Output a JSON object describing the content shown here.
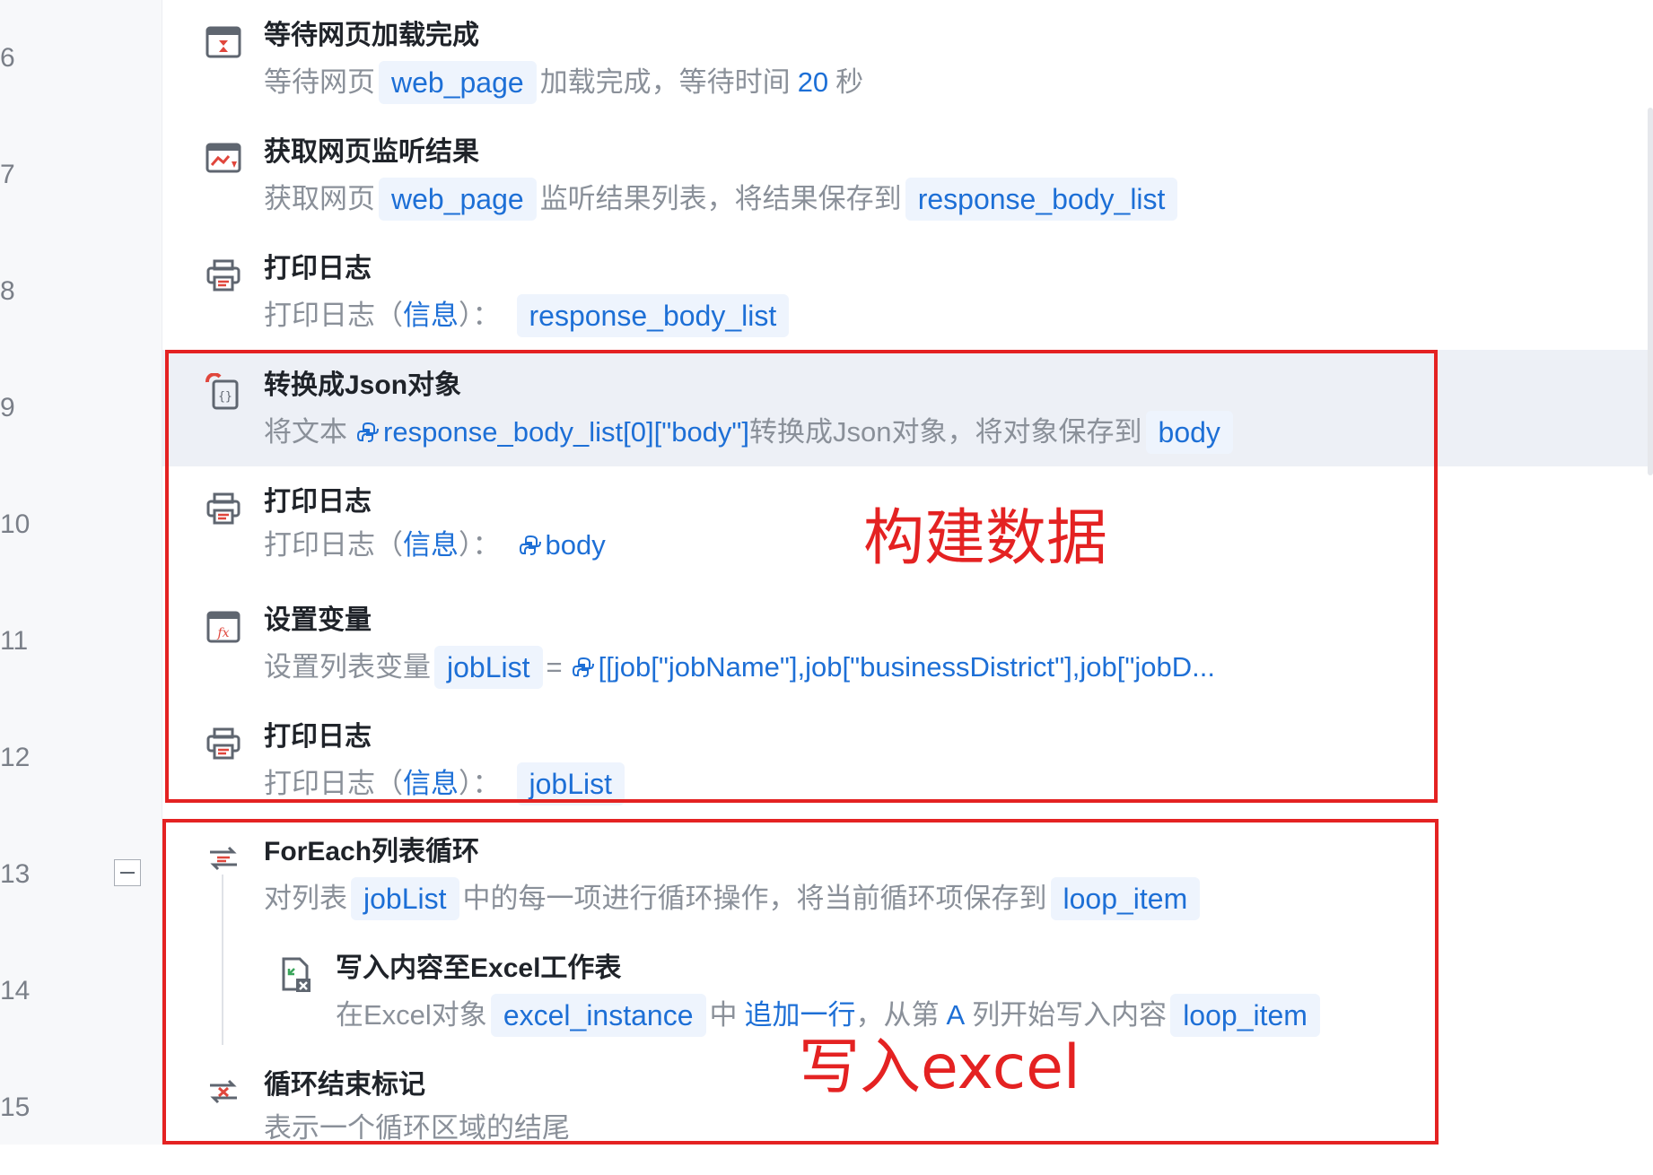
{
  "line_numbers": [
    "6",
    "7",
    "8",
    "9",
    "10",
    "11",
    "12",
    "13",
    "14",
    "15"
  ],
  "steps": [
    {
      "title": "等待网页加载完成",
      "desc": {
        "p1": "等待网页",
        "chip1": "web_page",
        "p2": "加载完成，等待时间",
        "value": "20",
        "p3": "秒"
      }
    },
    {
      "title": "获取网页监听结果",
      "desc": {
        "p1": "获取网页",
        "chip1": "web_page",
        "p2": "监听结果列表，将结果保存到",
        "chip2": "response_body_list"
      }
    },
    {
      "title": "打印日志",
      "desc": {
        "p1": "打印日志",
        "paren_open": "（",
        "level": "信息",
        "paren_close": "）：",
        "chip1": "response_body_list"
      }
    },
    {
      "title": "转换成Json对象",
      "desc": {
        "p1": "将文本",
        "expr": "response_body_list[0][\"body\"]",
        "p2": "转换成Json对象，将对象保存到",
        "chip1": "body"
      }
    },
    {
      "title": "打印日志",
      "desc": {
        "p1": "打印日志",
        "paren_open": "（",
        "level": "信息",
        "paren_close": "）：",
        "expr": "body"
      }
    },
    {
      "title": "设置变量",
      "desc": {
        "p1": "设置列表变量",
        "chip1": "jobList",
        "eq": "=",
        "expr": "[[job[\"jobName\"],job[\"businessDistrict\"],job[\"jobD..."
      }
    },
    {
      "title": "打印日志",
      "desc": {
        "p1": "打印日志",
        "paren_open": "（",
        "level": "信息",
        "paren_close": "）：",
        "chip1": "jobList"
      }
    },
    {
      "title": "ForEach列表循环",
      "desc": {
        "p1": "对列表",
        "chip1": "jobList",
        "p2": "中的每一项进行循环操作，将当前循环项保存到",
        "chip2": "loop_item"
      }
    },
    {
      "title": "写入内容至Excel工作表",
      "desc": {
        "p1": "在Excel对象",
        "chip1": "excel_instance",
        "p2": "中",
        "mode": "追加一行",
        "p3": "，从第",
        "col": "A",
        "p4": "列开始写入内容",
        "chip2": "loop_item"
      }
    },
    {
      "title": "循环结束标记",
      "desc": {
        "p1": "表示一个循环区域的结尾"
      }
    }
  ],
  "annotations": {
    "build": "构建数据",
    "write": "写入excel"
  },
  "colors": {
    "accent": "#1d6fd6",
    "annotation": "#e42222",
    "highlight_row": "#edf0f6"
  },
  "icons": [
    "wait-page-icon",
    "monitor-icon",
    "print-icon",
    "json-icon",
    "variable-icon",
    "loop-icon",
    "excel-write-icon",
    "loop-end-icon",
    "python-icon"
  ]
}
